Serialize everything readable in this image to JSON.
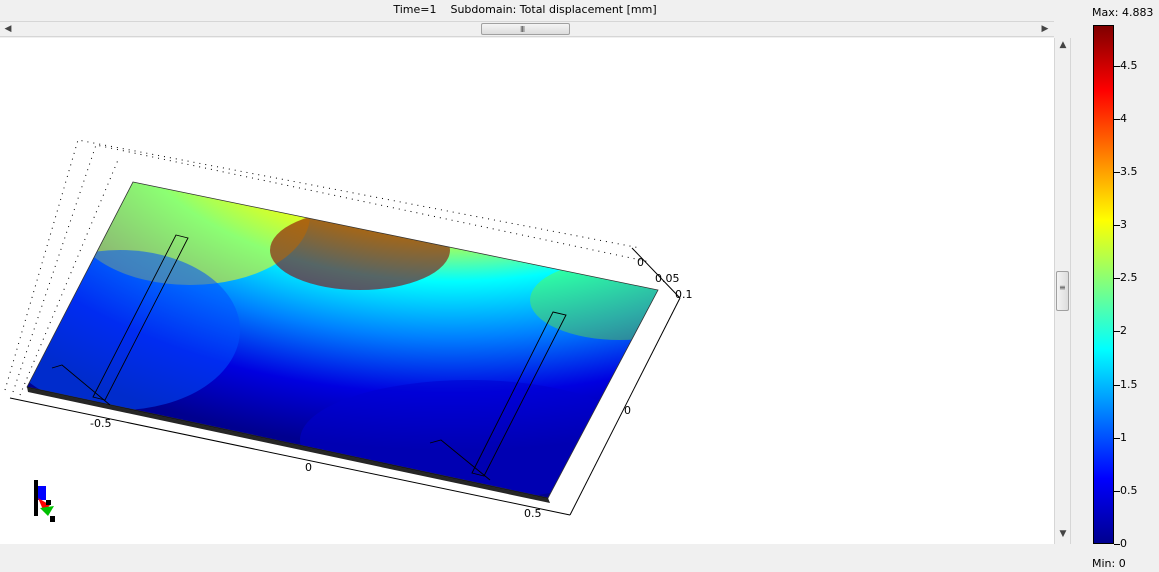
{
  "title": "Time=1    Subdomain: Total displacement [mm]",
  "scrollbars": {
    "horizontal_grip": "III",
    "vertical_grip": "≡"
  },
  "axes": {
    "x_ticks": [
      "-0.5",
      "0",
      "0.5"
    ],
    "y_ticks": [
      "0"
    ],
    "z_ticks": [
      "0",
      "0.05",
      "0.1"
    ]
  },
  "colorbar": {
    "max_label": "Max: 4.883",
    "min_label": "Min: 0",
    "ticks": [
      "4.5",
      "4",
      "3.5",
      "3",
      "2.5",
      "2",
      "1.5",
      "1",
      "0.5",
      "0"
    ],
    "colormap": "jet",
    "colors": [
      "#00008f",
      "#0000ff",
      "#00ffff",
      "#ffff00",
      "#ff0000",
      "#800000"
    ]
  },
  "axis_triad_colors": {
    "x": "#ff0000",
    "y": "#00c000",
    "z": "#0000ff"
  }
}
